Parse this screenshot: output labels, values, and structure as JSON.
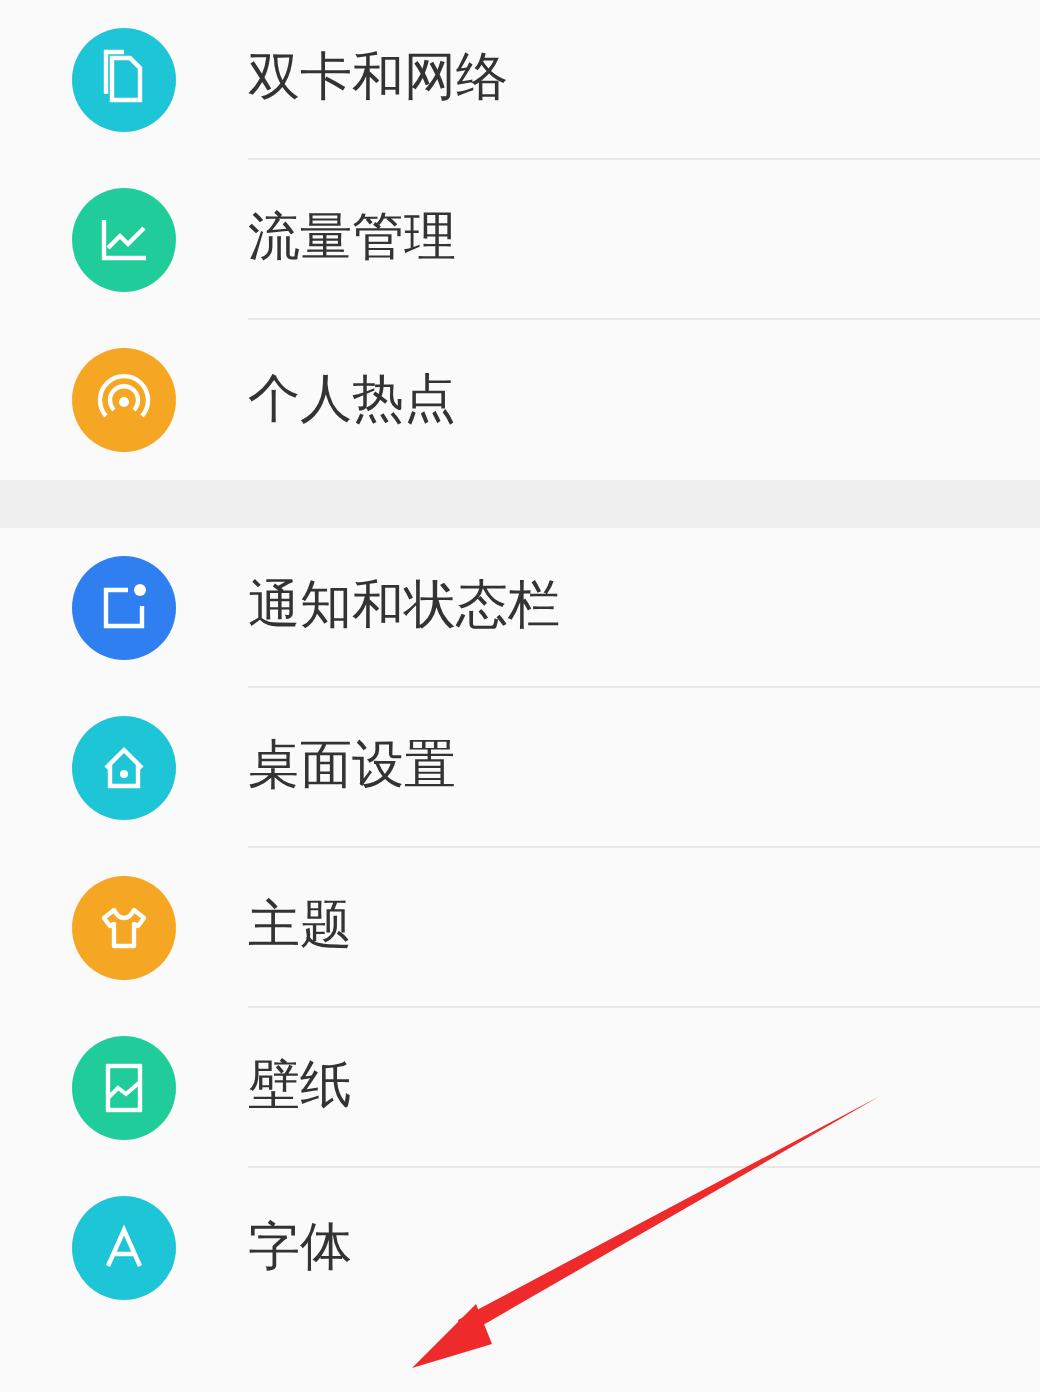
{
  "sections": [
    {
      "items": [
        {
          "label": "双卡和网络",
          "color": "#1ec5d6"
        },
        {
          "label": "流量管理",
          "color": "#1fcc9a"
        },
        {
          "label": "个人热点",
          "color": "#f5a623"
        }
      ]
    },
    {
      "items": [
        {
          "label": "通知和状态栏",
          "color": "#2f7ff0"
        },
        {
          "label": "桌面设置",
          "color": "#1ec5d6"
        },
        {
          "label": "主题",
          "color": "#f5a623"
        },
        {
          "label": "壁纸",
          "color": "#1fcc9a"
        },
        {
          "label": "字体",
          "color": "#1ec5d6"
        }
      ]
    }
  ]
}
